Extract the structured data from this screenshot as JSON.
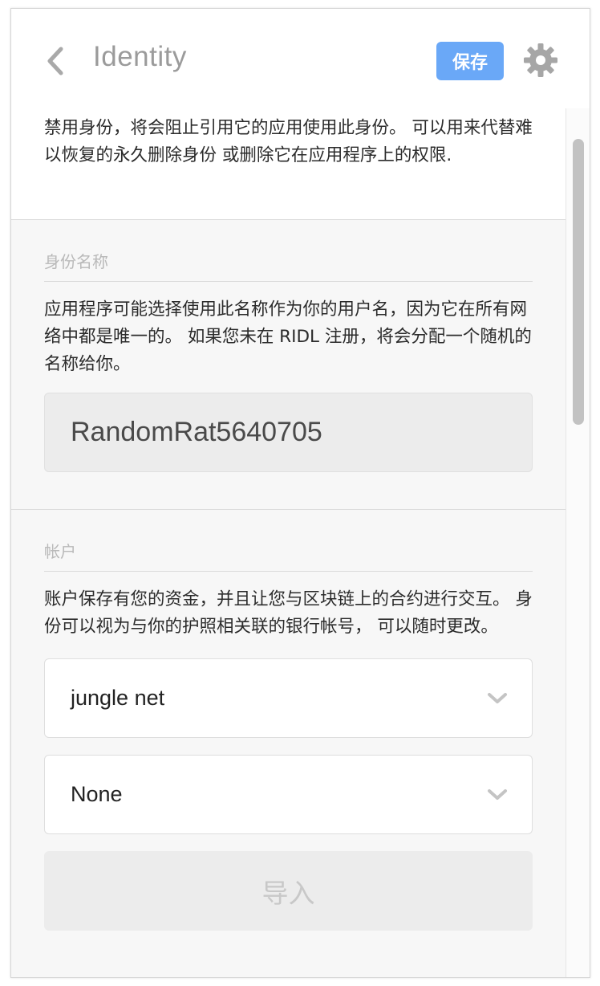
{
  "header": {
    "title": "Identity",
    "save_label": "保存"
  },
  "intro": {
    "text": "禁用身份，将会阻止引用它的应用使用此身份。 可以用来代替难以恢复的永久删除身份 或删除它在应用程序上的权限."
  },
  "identity_section": {
    "title": "身份名称",
    "description": "应用程序可能选择使用此名称作为你的用户名，因为它在所有网络中都是唯一的。 如果您未在 RIDL 注册，将会分配一个随机的名称给你。",
    "name_value": "RandomRat5640705"
  },
  "account_section": {
    "title": "帐户",
    "description": "账户保存有您的资金，并且让您与区块链上的合约进行交互。 身份可以视为与你的护照相关联的银行帐号， 可以随时更改。",
    "network_selected": "jungle net",
    "account_selected": "None",
    "import_label": "导入"
  },
  "colors": {
    "accent": "#6aa8f7",
    "title_gray": "#9b9b9b",
    "panel_bg": "#f7f7f7"
  }
}
